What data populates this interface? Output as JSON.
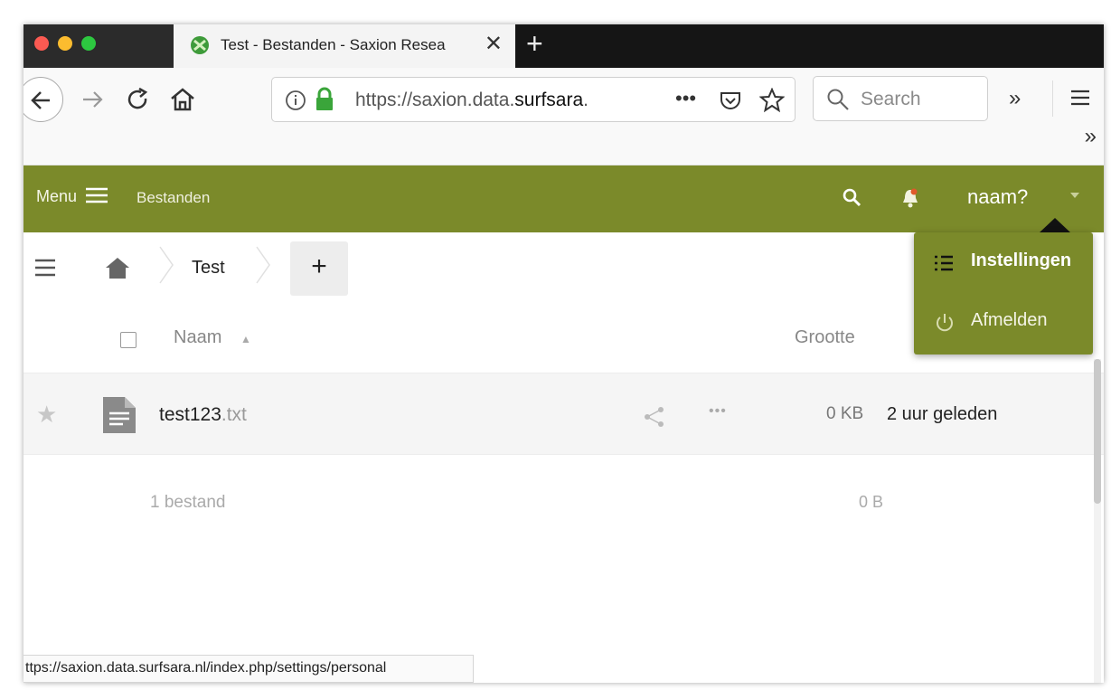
{
  "browser": {
    "tab_title": "Test - Bestanden - Saxion Resea",
    "url_prefix": "https://saxion.data.",
    "url_domain": "surfsara",
    "url_suffix": ".",
    "search_placeholder": "Search",
    "status_url": "ttps://saxion.data.surfsara.nl/index.php/settings/personal",
    "overflow_dot": "."
  },
  "header": {
    "menu_label": "Menu",
    "app_title": "Bestanden",
    "user_name": "naam?",
    "accent": "#7b8a2a"
  },
  "user_menu": {
    "items": [
      {
        "label": "Instellingen",
        "icon": "settings-list-icon"
      },
      {
        "label": "Afmelden",
        "icon": "power-icon"
      }
    ]
  },
  "breadcrumb": {
    "folder": "Test"
  },
  "table": {
    "headers": {
      "name": "Naam",
      "size": "Grootte"
    },
    "rows": [
      {
        "name": "test123",
        "ext": ".txt",
        "size": "0 KB",
        "modified": "2 uur geleden"
      }
    ],
    "summary": {
      "count": "1 bestand",
      "size": "0 B"
    }
  }
}
